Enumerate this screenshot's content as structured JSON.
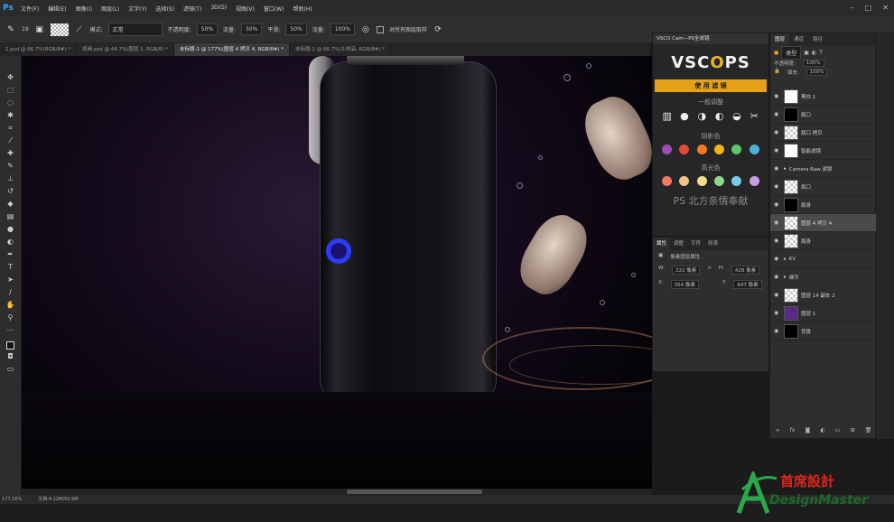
{
  "app": {
    "logo": "Ps"
  },
  "menu": [
    "文件(F)",
    "编辑(E)",
    "图像(I)",
    "图层(L)",
    "文字(Y)",
    "选择(S)",
    "滤镜(T)",
    "3D(D)",
    "视图(V)",
    "窗口(W)",
    "帮助(H)"
  ],
  "options": {
    "mode_label": "模式:",
    "mode_value": "正常",
    "opacity_label": "不透明度:",
    "opacity_value": "50%",
    "flow_label": "流量:",
    "flow_value": "50%",
    "smooth_label": "平滑:",
    "smooth_value": "50%",
    "size_label": "流量:",
    "size_value": "100%",
    "sample_all": "对所有图层取样",
    "brush_size": "19"
  },
  "tabs": [
    {
      "label": "1.psd @ 66.7%(RGB/8#) *",
      "active": false
    },
    {
      "label": "原画.psd @ 44.7%(图层 1, RGB/8) *",
      "active": false
    },
    {
      "label": "未标题-1 @ 177%(图层 4 拷贝 4, RGB/8#) *",
      "active": true
    },
    {
      "label": "未标题-2 @ 66.7%(3:样品, RGB/8#) *",
      "active": false
    }
  ],
  "status": {
    "zoom": "177.16%",
    "doc": "文档:4.12M/50.9M"
  },
  "vsco": {
    "title": "VSCO Cam—PS全滤镜",
    "logo_left": "VSC",
    "logo_o": "O",
    "logo_right": "PS",
    "use_button": "使 用 滤 镜",
    "section_general": "一般调整",
    "section_shadow": "阴影色",
    "section_highlight": "高光色",
    "signature": "PS 北方亲情奉献",
    "shadow_colors": [
      "#9b4fb5",
      "#e64a3e",
      "#f07c20",
      "#f2b418",
      "#5cc46a",
      "#4cb2d6"
    ],
    "highlight_colors": [
      "#f07866",
      "#f2c28c",
      "#f2de8c",
      "#8ed88c",
      "#78cde6",
      "#c79de6"
    ]
  },
  "properties": {
    "tabs": [
      "属性",
      "调整",
      "字符",
      "段落"
    ],
    "title": "像素图层属性",
    "w_label": "W:",
    "w_value": "222 像素",
    "h_label": "H:",
    "h_value": "428 像素",
    "x_label": "X:",
    "x_value": "354 像素",
    "y_label": "Y:",
    "y_value": "647 像素"
  },
  "layers_panel": {
    "tabs": [
      "图层",
      "通道",
      "路径"
    ],
    "filter": "类型",
    "opacity_label": "不透明度:",
    "opacity_value": "100%",
    "fill_label": "填充:",
    "fill_value": "100%",
    "layers": [
      {
        "name": "黑白 1",
        "thumb": "white",
        "selected": false
      },
      {
        "name": "瓶口",
        "thumb": "black",
        "selected": false
      },
      {
        "name": "瓶口 拷贝",
        "thumb": "checker",
        "selected": false
      },
      {
        "name": "智能滤镜",
        "thumb": "white",
        "selected": false
      },
      {
        "name": "Camera Raw 滤镜",
        "thumb": "none",
        "selected": false
      },
      {
        "name": "瓶口",
        "thumb": "checker",
        "selected": false
      },
      {
        "name": "瓶身",
        "thumb": "black",
        "selected": false
      },
      {
        "name": "图层 4 拷贝 4",
        "thumb": "checker",
        "selected": true
      },
      {
        "name": "瓶身",
        "thumb": "checker",
        "selected": false
      },
      {
        "name": "KV",
        "thumb": "none",
        "selected": false
      },
      {
        "name": "细节",
        "thumb": "none",
        "selected": false
      },
      {
        "name": "图层 14 副本 2",
        "thumb": "checker",
        "selected": false
      },
      {
        "name": "图层 1",
        "thumb": "purple",
        "selected": false
      },
      {
        "name": "背景",
        "thumb": "black",
        "selected": false
      }
    ]
  },
  "watermark": {
    "title": "首席設計",
    "subtitle": "DesignMaster"
  }
}
